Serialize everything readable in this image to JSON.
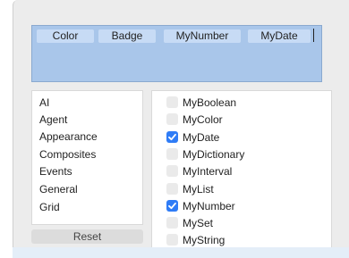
{
  "tokens": [
    "Color",
    "Badge",
    "MyNumber",
    "MyDate"
  ],
  "left_list": [
    "AI",
    "Agent",
    "Appearance",
    "Composites",
    "Events",
    "General",
    "Grid"
  ],
  "reset_label": "Reset",
  "checklist": [
    {
      "label": "MyBoolean",
      "checked": false
    },
    {
      "label": "MyColor",
      "checked": false
    },
    {
      "label": "MyDate",
      "checked": true
    },
    {
      "label": "MyDictionary",
      "checked": false
    },
    {
      "label": "MyInterval",
      "checked": false
    },
    {
      "label": "MyList",
      "checked": false
    },
    {
      "label": "MyNumber",
      "checked": true
    },
    {
      "label": "MySet",
      "checked": false
    },
    {
      "label": "MyString",
      "checked": false
    }
  ],
  "colors": {
    "accent": "#2f7cf6",
    "token_bg": "#c7dbf5",
    "field_bg": "#a9c6ea"
  }
}
